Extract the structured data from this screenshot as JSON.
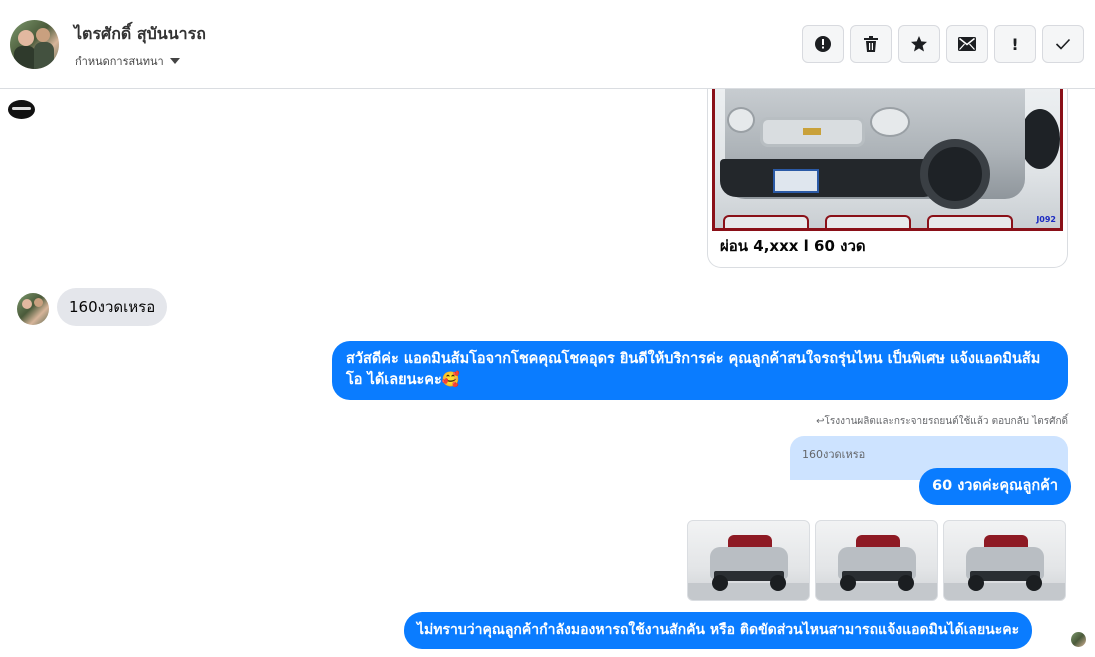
{
  "header": {
    "user_name": "ไตรศักดิ์ สุบันนารถ",
    "subtitle": "กำหนดการสนทนา",
    "actions": [
      {
        "name": "report-button",
        "icon": "alert-circle-icon",
        "glyph": ""
      },
      {
        "name": "delete-button",
        "icon": "trash-icon",
        "glyph": ""
      },
      {
        "name": "star-button",
        "icon": "star-icon",
        "glyph": ""
      },
      {
        "name": "mark-unread-button",
        "icon": "envelope-icon",
        "glyph": ""
      },
      {
        "name": "priority-button",
        "icon": "exclamation-icon",
        "glyph": "!"
      },
      {
        "name": "mark-done-button",
        "icon": "check-icon",
        "glyph": ""
      }
    ]
  },
  "messages": {
    "card_caption": "ผ่อน 4,xxx l 60 งวด",
    "card_code": "J092",
    "incoming_1": "160งวดเหรอ",
    "outgoing_greeting": "สวัสดีค่ะ แอดมินส้มโอจากโชคคุณโชคอุดร ยินดีให้บริการค่ะ   คุณลูกค้าสนใจรถรุ่นไหน เป็นพิเศษ แจ้งแอดมินส้มโอ ได้เลยนะคะ🥰",
    "reply_meta": "↩โรงงานผลิตและกระจายรถยนต์ใช้แล้ว ตอบกลับ ไตรศักดิ์",
    "reply_quote": "160งวดเหรอ",
    "outgoing_60": "60 งวดค่ะคุณลูกค้า",
    "outgoing_final": "ไม่ทราบว่าคุณลูกค้ากำลังมองหารถใช้งานสักคัน หรือ ติดขัดส่วนไหนสามารถแจ้งแอดมินได้เลยนะคะ"
  },
  "colors": {
    "outgoing_bubble": "#0a7cff",
    "incoming_bubble": "#e4e6eb",
    "reply_quote_bg": "#cde3ff",
    "card_frame": "#8a1018"
  }
}
